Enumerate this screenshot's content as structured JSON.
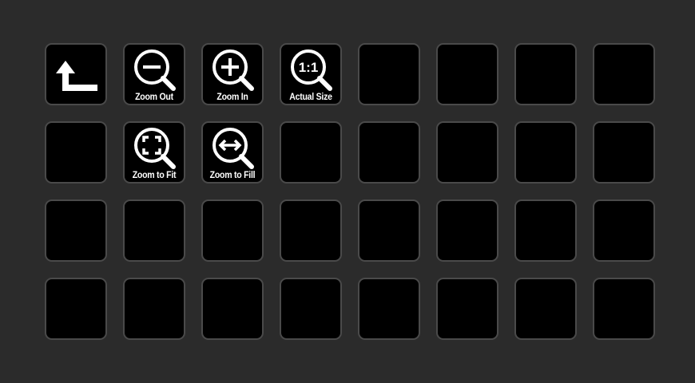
{
  "keys": [
    {
      "type": "back",
      "icon": "back-arrow-icon"
    },
    {
      "type": "zoom",
      "icon": "zoom-out-icon",
      "label": "Zoom Out"
    },
    {
      "type": "zoom",
      "icon": "zoom-in-icon",
      "label": "Zoom In"
    },
    {
      "type": "zoom",
      "icon": "actual-size-icon",
      "label": "Actual Size",
      "glyph": "1:1"
    },
    {
      "type": "empty"
    },
    {
      "type": "empty"
    },
    {
      "type": "empty"
    },
    {
      "type": "empty"
    },
    {
      "type": "empty"
    },
    {
      "type": "zoom",
      "icon": "zoom-to-fit-icon",
      "label": "Zoom to Fit"
    },
    {
      "type": "zoom",
      "icon": "zoom-to-fill-icon",
      "label": "Zoom to Fill"
    },
    {
      "type": "empty"
    },
    {
      "type": "empty"
    },
    {
      "type": "empty"
    },
    {
      "type": "empty"
    },
    {
      "type": "empty"
    },
    {
      "type": "empty"
    },
    {
      "type": "empty"
    },
    {
      "type": "empty"
    },
    {
      "type": "empty"
    },
    {
      "type": "empty"
    },
    {
      "type": "empty"
    },
    {
      "type": "empty"
    },
    {
      "type": "empty"
    },
    {
      "type": "empty"
    },
    {
      "type": "empty"
    },
    {
      "type": "empty"
    },
    {
      "type": "empty"
    },
    {
      "type": "empty"
    },
    {
      "type": "empty"
    },
    {
      "type": "empty"
    },
    {
      "type": "empty"
    }
  ]
}
